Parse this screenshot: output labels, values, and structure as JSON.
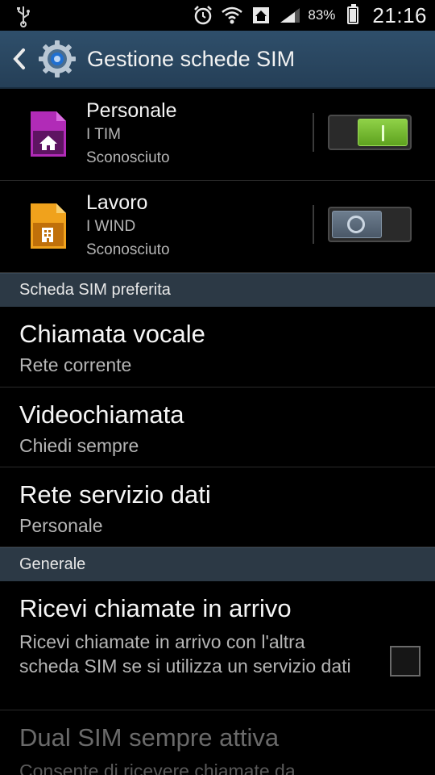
{
  "statusbar": {
    "battery_percent": "83%",
    "time": "21:16",
    "icons": [
      "usb-icon",
      "alarm-icon",
      "wifi-icon",
      "home-icon",
      "signal-icon",
      "battery-charging-icon"
    ]
  },
  "actionbar": {
    "title": "Gestione schede SIM",
    "back_icon": "chevron-left-icon",
    "app_icon": "gear-icon"
  },
  "sims": [
    {
      "name": "Personale",
      "carrier": "I TIM",
      "status": "Sconosciuto",
      "color": "#b12bb7",
      "icon": "home-icon",
      "enabled": true
    },
    {
      "name": "Lavoro",
      "carrier": "I WIND",
      "status": "Sconosciuto",
      "color": "#f0a21c",
      "icon": "building-icon",
      "enabled": false
    }
  ],
  "sections": {
    "preferred": "Scheda SIM preferita",
    "general": "Generale"
  },
  "preferred": {
    "voice_call": {
      "title": "Chiamata vocale",
      "value": "Rete corrente"
    },
    "video_call": {
      "title": "Videochiamata",
      "value": "Chiedi sempre"
    },
    "data_network": {
      "title": "Rete servizio dati",
      "value": "Personale"
    }
  },
  "general": {
    "incoming": {
      "title": "Ricevi chiamate in arrivo",
      "desc": "Ricevi chiamate in arrivo con l'altra scheda SIM se si utilizza un servizio dati",
      "checked": false
    },
    "dual_sim": {
      "title": "Dual SIM sempre attiva",
      "desc": "Consente di ricevere chiamate da"
    }
  },
  "colors": {
    "actionbar": "#2f4f6b",
    "section_header": "#2c3945",
    "switch_on": "#6db22a"
  }
}
